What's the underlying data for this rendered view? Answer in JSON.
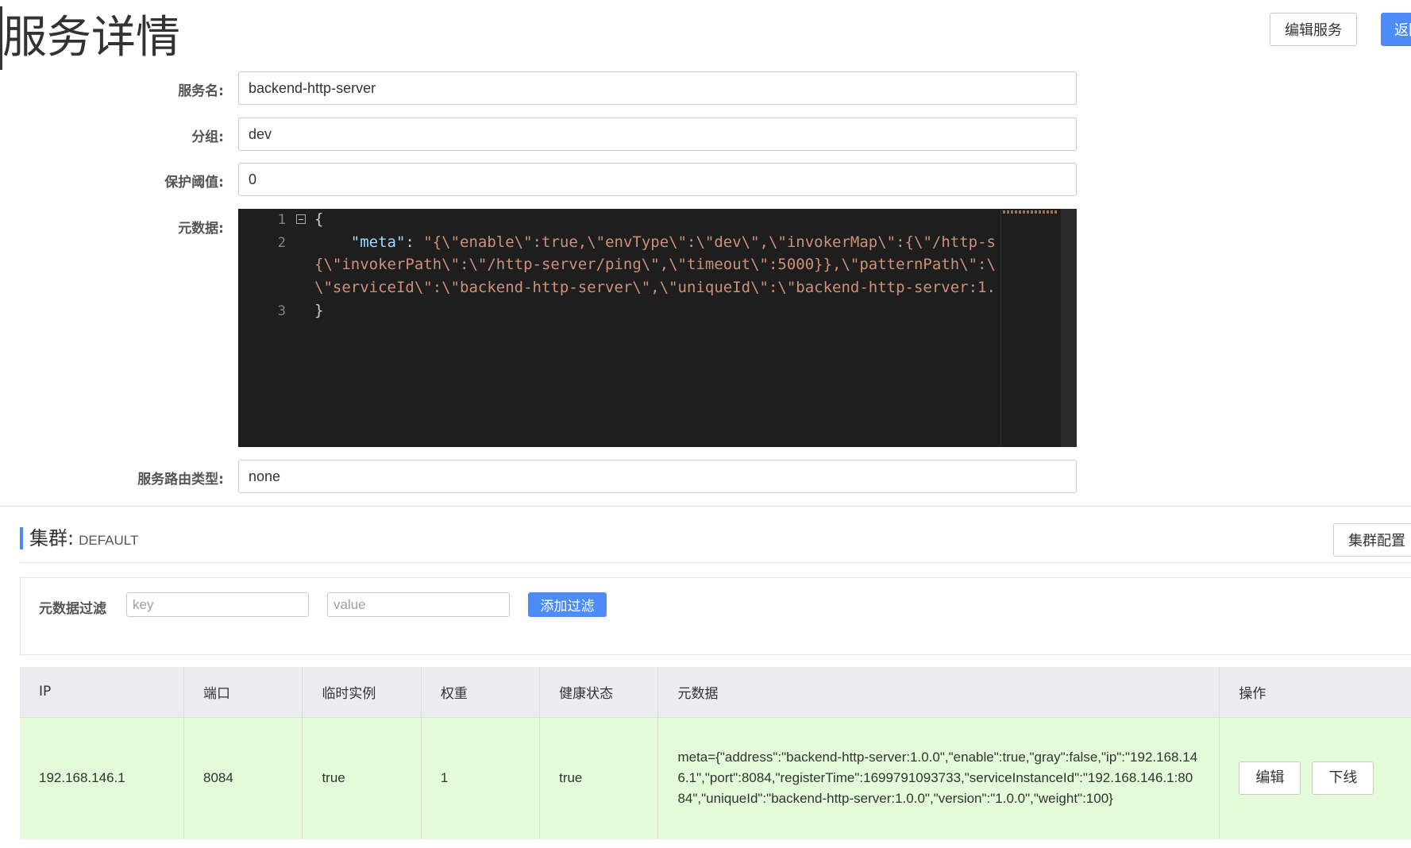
{
  "header": {
    "title": "服务详情",
    "edit_service_label": "编辑服务",
    "back_label": "返回"
  },
  "form": {
    "service_name": {
      "label": "服务名:",
      "value": "backend-http-server"
    },
    "group": {
      "label": "分组:",
      "value": "dev"
    },
    "protect_threshold": {
      "label": "保护阈值:",
      "value": "0"
    },
    "metadata": {
      "label": "元数据:",
      "line_numbers": [
        "1",
        "2",
        "3"
      ],
      "lines": {
        "open_brace": "{",
        "key": "\"meta\"",
        "colon": ": ",
        "value_part1": "\"{\\\"enable\\\":true,\\\"envType\\\":\\\"dev\\\",\\\"invokerMap\\\":{\\\"/http-s",
        "value_part2": "{\\\"invokerPath\\\":\\\"/http-server/ping\\\",\\\"timeout\\\":5000}},\\\"patternPath\\\":\\",
        "value_part3": "\\\"serviceId\\\":\\\"backend-http-server\\\",\\\"uniqueId\\\":\\\"backend-http-server:1.",
        "close_brace": "}"
      }
    },
    "route_type": {
      "label": "服务路由类型:",
      "value": "none"
    }
  },
  "cluster": {
    "title": "集群:",
    "name": "DEFAULT",
    "config_label": "集群配置",
    "filter": {
      "label": "元数据过滤",
      "key_placeholder": "key",
      "value_placeholder": "value",
      "add_label": "添加过滤"
    },
    "table": {
      "headers": [
        "IP",
        "端口",
        "临时实例",
        "权重",
        "健康状态",
        "元数据",
        "操作"
      ],
      "rows": [
        {
          "ip": "192.168.146.1",
          "port": "8084",
          "ephemeral": "true",
          "weight": "1",
          "healthy": "true",
          "metadata": "meta={\"address\":\"backend-http-server:1.0.0\",\"enable\":true,\"gray\":false,\"ip\":\"192.168.146.1\",\"port\":8084,\"registerTime\":1699791093733,\"serviceInstanceId\":\"192.168.146.1:8084\",\"uniqueId\":\"backend-http-server:1.0.0\",\"version\":\"1.0.0\",\"weight\":100}",
          "edit_label": "编辑",
          "offline_label": "下线"
        }
      ]
    }
  },
  "colors": {
    "primary": "#4b8cf7",
    "row_healthy_bg": "#e3fbd9",
    "header_bg": "#eaecef",
    "editor_bg": "#1e1e1e"
  }
}
